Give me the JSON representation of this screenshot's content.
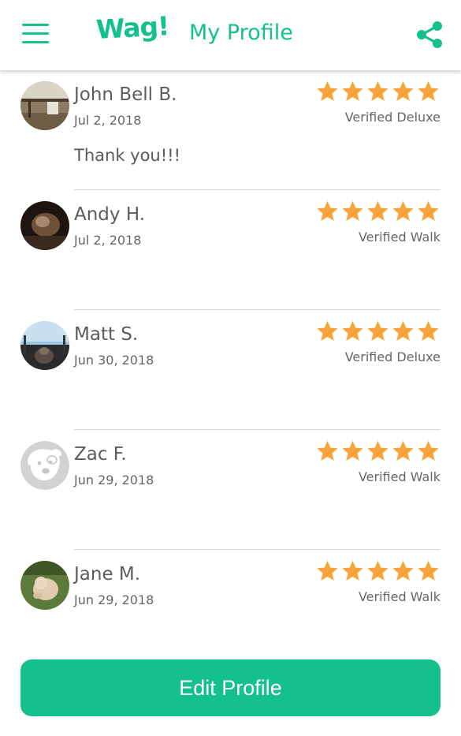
{
  "header": {
    "logo_text": "Wag!",
    "title": "My Profile",
    "menu_icon": "hamburger-menu-icon",
    "share_icon": "share-icon"
  },
  "colors": {
    "accent": "#14c08c",
    "star": "#f7a33a",
    "divider": "#d8d8d8"
  },
  "reviews": [
    {
      "name": "John Bell B.",
      "date": "Jul 2, 2018",
      "badge": "Verified Deluxe",
      "rating": 5,
      "comment": "Thank you!!!"
    },
    {
      "name": "Andy H.",
      "date": "Jul 2, 2018",
      "badge": "Verified Walk",
      "rating": 5,
      "comment": ""
    },
    {
      "name": "Matt S.",
      "date": "Jun 30, 2018",
      "badge": "Verified Deluxe",
      "rating": 5,
      "comment": ""
    },
    {
      "name": "Zac F.",
      "date": "Jun 29, 2018",
      "badge": "Verified Walk",
      "rating": 5,
      "comment": ""
    },
    {
      "name": "Jane M.",
      "date": "Jun 29, 2018",
      "badge": "Verified Walk",
      "rating": 5,
      "comment": ""
    }
  ],
  "footer": {
    "edit_button_label": "Edit Profile"
  }
}
